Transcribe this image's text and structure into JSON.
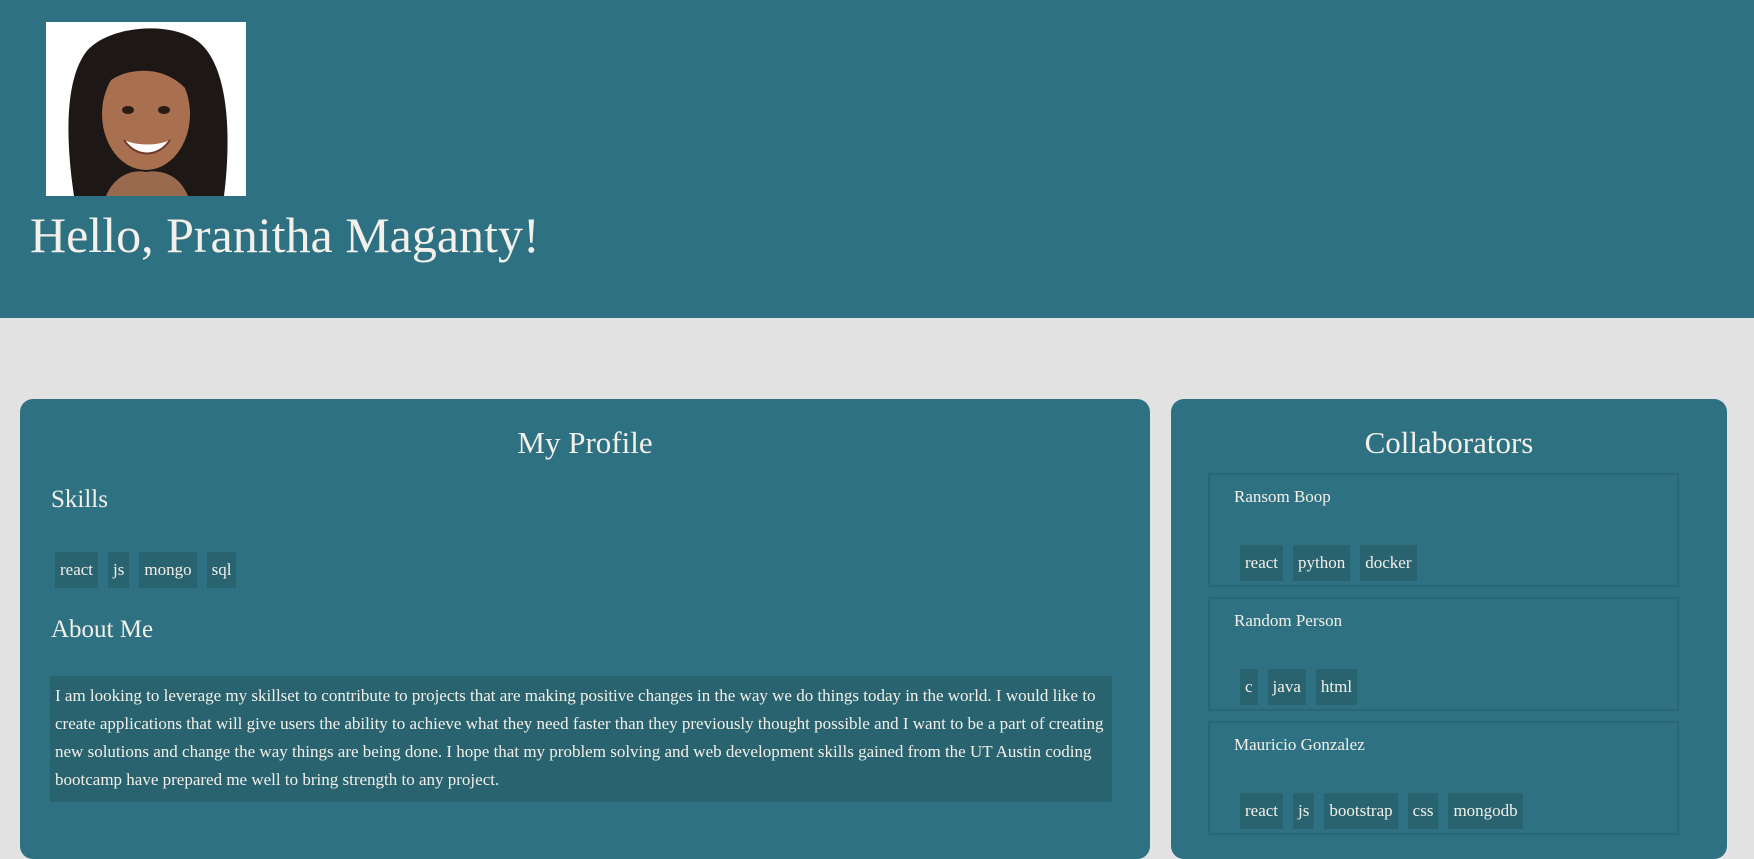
{
  "header": {
    "greeting": "Hello, Pranitha Maganty!"
  },
  "profile": {
    "title": "My Profile",
    "skills_heading": "Skills",
    "skills": [
      "react",
      "js",
      "mongo",
      "sql"
    ],
    "about_heading": "About Me",
    "about_text": "I am looking to leverage my skillset to contribute to projects that are making positive changes in the way we do things today in the world. I would like to create applications that will give users the ability to achieve what they need faster than they previously thought possible and I want to be a part of creating new solutions and change the way things are being done. I hope that my problem solving and web development skills gained from the UT Austin coding bootcamp have prepared me well to bring strength to any project."
  },
  "collaborators": {
    "title": "Collaborators",
    "items": [
      {
        "name": "Ransom Boop",
        "skills": [
          "react",
          "python",
          "docker"
        ]
      },
      {
        "name": "Random Person",
        "skills": [
          "c",
          "java",
          "html"
        ]
      },
      {
        "name": "Mauricio Gonzalez",
        "skills": [
          "react",
          "js",
          "bootstrap",
          "css",
          "mongodb"
        ]
      }
    ]
  },
  "colors": {
    "primary": "#2e7182",
    "tag_background": "#29636f",
    "page_background": "#e2e2e2",
    "text": "#f2f0e9"
  }
}
